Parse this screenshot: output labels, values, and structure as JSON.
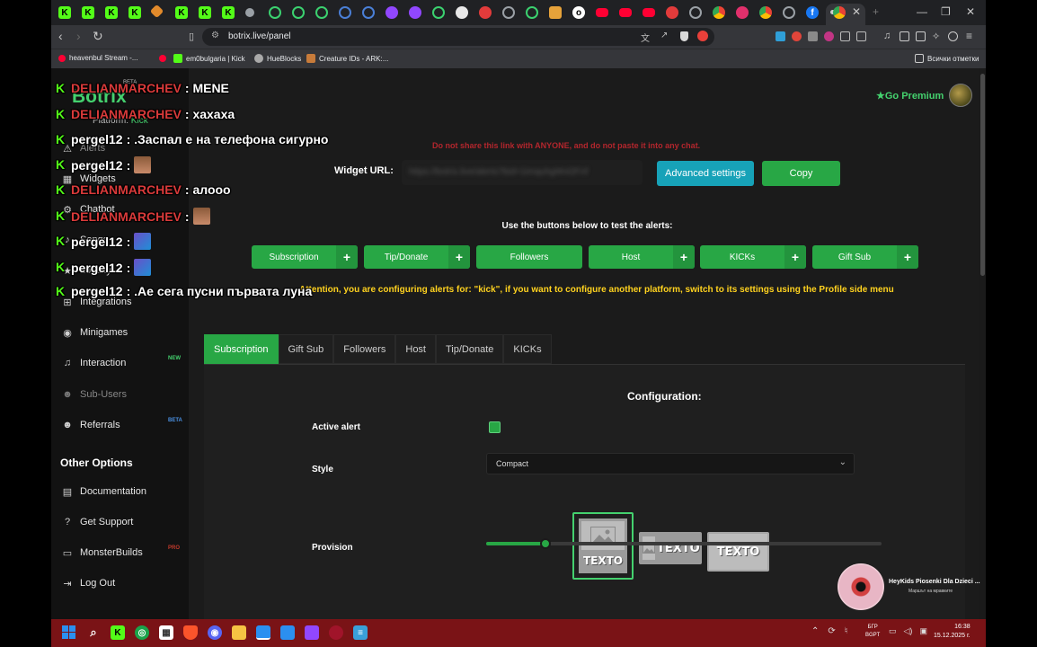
{
  "browser": {
    "tabs_favicons": [
      "kick",
      "kick",
      "kick",
      "kick",
      "orange",
      "kick",
      "kick",
      "kick",
      "gray-round",
      "teal-ring",
      "teal-ring",
      "teal-ring",
      "blue-ring",
      "blue-ring",
      "purple",
      "purple",
      "green-ring",
      "black-round",
      "red-round",
      "gray-ring",
      "green-ring",
      "shopping",
      "black-round",
      "youtube",
      "youtube",
      "youtube",
      "red-round",
      "gray-ring",
      "chrome",
      "instagram",
      "chrome",
      "gray-ring",
      "facebook",
      "tiny",
      "chrome-active"
    ],
    "url": "botrix.live/panel",
    "window_controls": {
      "minimize": "—",
      "restore": "❐",
      "close": "✕"
    },
    "bookmarks": [
      {
        "label": "heavenbul Stream -...",
        "icon": "youtube"
      },
      {
        "label": "em0bulgaria | Kick",
        "icon": "kick"
      },
      {
        "label": "HueBlocks",
        "icon": "hueblocks"
      },
      {
        "label": "Creature IDs - ARK:...",
        "icon": "ark"
      }
    ],
    "all_bookmarks": "Всички отметки"
  },
  "app": {
    "logo": "Botrix",
    "logo_badge": "BETA",
    "platform_label": "Platform:",
    "platform_value": "Kick",
    "go_premium": "Go Premium",
    "sidebar": [
      {
        "label": "Alerts",
        "icon": "bell-icon",
        "dim": true
      },
      {
        "label": "Widgets",
        "icon": "widgets-icon"
      },
      {
        "label": "Chatbot",
        "icon": "robot-icon"
      },
      {
        "label": "Songs",
        "icon": "music-icon"
      },
      {
        "label": "Loyalty",
        "icon": "star-icon"
      },
      {
        "label": "Integrations",
        "icon": "plug-icon"
      },
      {
        "label": "Minigames",
        "icon": "gamepad-icon"
      },
      {
        "label": "Interaction",
        "icon": "music-note-icon",
        "badge": "NEW"
      },
      {
        "label": "Sub-Users",
        "icon": "users-icon",
        "dim": true
      },
      {
        "label": "Referrals",
        "icon": "user-group-icon",
        "badge": "BETA"
      }
    ],
    "other_options_title": "Other Options",
    "other_options": [
      {
        "label": "Documentation",
        "icon": "book-icon"
      },
      {
        "label": "Get Support",
        "icon": "question-icon"
      },
      {
        "label": "MonsterBuilds",
        "icon": "laptop-icon",
        "badge": "PRO"
      },
      {
        "label": "Log Out",
        "icon": "logout-icon"
      }
    ]
  },
  "alerts": {
    "warning": "Do not share this link with ANYONE, and do not paste it into any chat.",
    "widget_url_label": "Widget URL:",
    "widget_url_value": "https://botrix.live/alerts?bid=1imquhgWvl2Fnf",
    "advanced_settings": "Advanced settings",
    "copy": "Copy",
    "test_hint": "Use the buttons below to test the alerts:",
    "test_buttons": [
      "Subscription",
      "Tip/Donate",
      "Followers",
      "Host",
      "KICKs",
      "Gift Sub"
    ],
    "attention": "Attention, you are configuring alerts for: \"kick\", if you want to configure another platform, switch to its settings using the Profile side menu",
    "tabs": [
      "Subscription",
      "Gift Sub",
      "Followers",
      "Host",
      "Tip/Donate",
      "KICKs"
    ],
    "active_tab": "Subscription",
    "configuration_title": "Configuration:",
    "active_alert_label": "Active alert",
    "active_alert_checked": true,
    "style_label": "Style",
    "style_value": "Compact",
    "provision_label": "Provision",
    "provision_options": [
      "TEXTO",
      "TEXTO",
      "TEXTO"
    ],
    "provision_selected_index": 0,
    "slider_fraction": 0.15
  },
  "chat": [
    {
      "user": "DELIANMARCHEV",
      "color": "#d93a3a",
      "message": ": MENE"
    },
    {
      "user": "DELIANMARCHEV",
      "color": "#d93a3a",
      "message": ": хахаха"
    },
    {
      "user": "pergel12",
      "color": "#ffffff",
      "message": ": .Заспал е на телефона сигурно"
    },
    {
      "user": "pergel12",
      "color": "#ffffff",
      "message": ":",
      "emote": "face-emote"
    },
    {
      "user": "DELIANMARCHEV",
      "color": "#d93a3a",
      "message": ": алоoo"
    },
    {
      "user": "DELIANMARCHEV",
      "color": "#d93a3a",
      "message": ":",
      "emote": "face-emote"
    },
    {
      "user": "pergel12",
      "color": "#ffffff",
      "message": ":",
      "emote": "pixel-emote"
    },
    {
      "user": "pergel12",
      "color": "#ffffff",
      "message": ":",
      "emote": "pixel-emote"
    },
    {
      "user": "pergel12",
      "color": "#ffffff",
      "message": ": .Ае сега пусни първата луна"
    }
  ],
  "media": {
    "title": "HeyKids Piosenki Dla Dzieci ...",
    "subtitle": "Маршът на мравките"
  },
  "taskbar": {
    "lang_top": "БГР",
    "lang_bottom": "BGPT",
    "time": "16:38",
    "date": "15.12.2025 г."
  },
  "colors": {
    "accent_green": "#28a745",
    "brand_green": "#44d16e",
    "info_blue": "#17a2b8",
    "warning_red": "#b3262d",
    "attention_yellow": "#ffd21f",
    "taskbar_red": "#7a1316"
  }
}
